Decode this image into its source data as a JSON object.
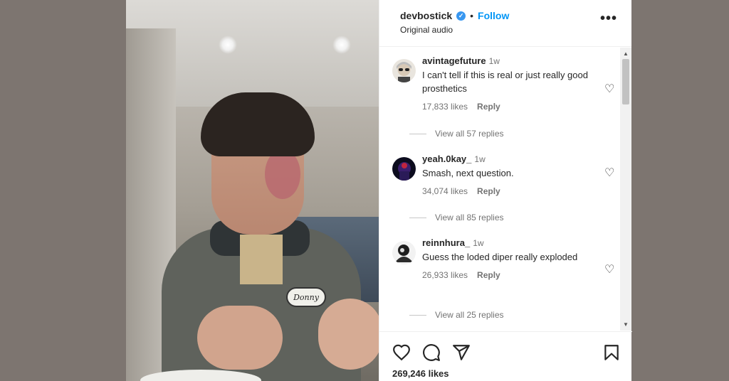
{
  "post": {
    "username": "devbostick",
    "separator": "•",
    "follow_label": "Follow",
    "audio": "Original audio",
    "more_label": "•••",
    "name_patch": "Donny",
    "likes": "269,246 likes"
  },
  "comments": [
    {
      "user": "avintagefuture",
      "time": "1w",
      "text": "I can't tell if this is real or just really good prosthetics",
      "likes": "17,833 likes",
      "reply": "Reply",
      "view_replies": "View all 57 replies"
    },
    {
      "user": "yeah.0kay_",
      "time": "1w",
      "text": "Smash, next question.",
      "likes": "34,074 likes",
      "reply": "Reply",
      "view_replies": "View all 85 replies"
    },
    {
      "user": "reinnhura_",
      "time": "1w",
      "text": "Guess the loded diper really exploded",
      "likes": "26,933 likes",
      "reply": "Reply",
      "view_replies": "View all 25 replies"
    }
  ],
  "icons": {
    "verified": "verified-badge-icon",
    "like": "heart-icon",
    "comment": "comment-icon",
    "share": "share-icon",
    "save": "bookmark-icon"
  },
  "colors": {
    "accent": "#0095f6",
    "verified": "#3897f0",
    "text": "#262626",
    "muted": "#737373",
    "backdrop": "#7d7570"
  }
}
